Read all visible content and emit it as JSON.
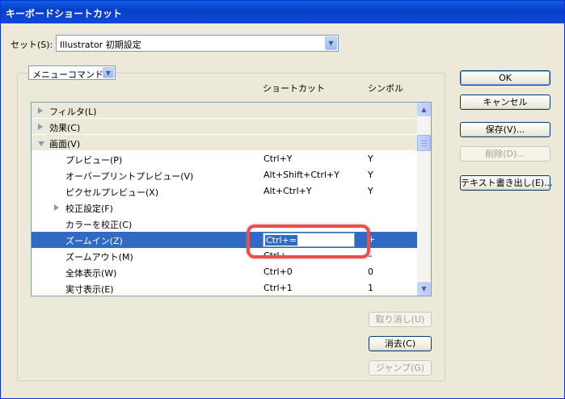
{
  "window": {
    "title": "キーボードショートカット"
  },
  "set": {
    "label": "セット(S):",
    "value": "Illustrator 初期設定"
  },
  "category_combo": {
    "value": "メニューコマンド"
  },
  "columns": {
    "shortcut": "ショートカット",
    "symbol": "シンボル"
  },
  "rows": [
    {
      "name": "フィルタ(L)",
      "shortcut": "",
      "symbol": "",
      "type": "cat",
      "expand": "collapsed"
    },
    {
      "name": "効果(C)",
      "shortcut": "",
      "symbol": "",
      "type": "cat",
      "expand": "collapsed"
    },
    {
      "name": "画面(V)",
      "shortcut": "",
      "symbol": "",
      "type": "cat",
      "expand": "expanded"
    },
    {
      "name": "プレビュー(P)",
      "shortcut": "Ctrl+Y",
      "symbol": "Y",
      "type": "item"
    },
    {
      "name": "オーバープリントプレビュー(V)",
      "shortcut": "Alt+Shift+Ctrl+Y",
      "symbol": "Y",
      "type": "item"
    },
    {
      "name": "ピクセルプレビュー(X)",
      "shortcut": "Alt+Ctrl+Y",
      "symbol": "Y",
      "type": "item"
    },
    {
      "name": "校正設定(F)",
      "shortcut": "",
      "symbol": "",
      "type": "sub",
      "expand": "collapsed"
    },
    {
      "name": "カラーを校正(C)",
      "shortcut": "",
      "symbol": "",
      "type": "item"
    },
    {
      "name": "ズームイン(Z)",
      "shortcut": "Ctrl+=",
      "symbol": "+",
      "type": "selected"
    },
    {
      "name": "ズームアウト(M)",
      "shortcut": "Ctrl+-",
      "symbol": "–",
      "type": "item"
    },
    {
      "name": "全体表示(W)",
      "shortcut": "Ctrl+0",
      "symbol": "0",
      "type": "item"
    },
    {
      "name": "実寸表示(E)",
      "shortcut": "Ctrl+1",
      "symbol": "1",
      "type": "item"
    }
  ],
  "buttons": {
    "ok": "OK",
    "cancel": "キャンセル",
    "save": "保存(V)...",
    "delete": "削除(D)...",
    "export_text": "テキスト書き出し(E)...",
    "undo": "取り消し(U)",
    "clear": "消去(C)",
    "jump": "ジャンプ(G)"
  },
  "colors": {
    "selection": "#316ac5",
    "callout": "#e6504d",
    "titlebar": "#0a3fc8"
  }
}
